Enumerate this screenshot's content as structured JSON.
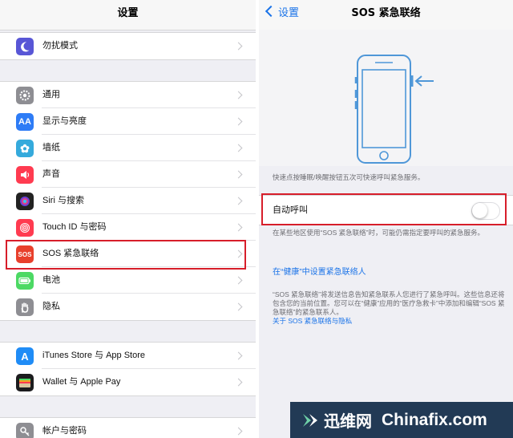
{
  "left": {
    "title": "设置",
    "items": [
      {
        "label": "勿扰模式",
        "icon": "moon-icon",
        "color": "#5856d6"
      },
      {
        "label": "通用",
        "icon": "gear-icon",
        "color": "#8e8e93"
      },
      {
        "label": "显示与亮度",
        "icon": "aa-icon",
        "glyph": "AA",
        "color": "#2e7cf6"
      },
      {
        "label": "墙纸",
        "icon": "flower-icon",
        "glyph": "✿",
        "color": "#35aadc"
      },
      {
        "label": "声音",
        "icon": "speaker-icon",
        "glyph": "🔊",
        "color": "#ff3b50"
      },
      {
        "label": "Siri 与搜索",
        "icon": "siri-icon",
        "color": "#222222"
      },
      {
        "label": "Touch ID 与密码",
        "icon": "fingerprint-icon",
        "color": "#ff3b50"
      },
      {
        "label": "SOS 紧急联络",
        "icon": "sos-icon",
        "glyph": "SOS",
        "color": "#e8402c"
      },
      {
        "label": "电池",
        "icon": "battery-icon",
        "color": "#4cd964"
      },
      {
        "label": "隐私",
        "icon": "hand-icon",
        "glyph": "✋",
        "color": "#8e8e93"
      },
      {
        "label": "iTunes Store 与 App Store",
        "icon": "appstore-icon",
        "glyph": "A",
        "color": "#1f8cf6"
      },
      {
        "label": "Wallet 与 Apple Pay",
        "icon": "wallet-icon",
        "color": "#1c1c1e"
      },
      {
        "label": "帐户与密码",
        "icon": "key-icon",
        "color": "#8e8e93"
      }
    ]
  },
  "right": {
    "back_label": "设置",
    "title": "SOS 紧急联络",
    "quick_note": "快速点按睡眠/唤醒按钮五次可快速呼叫紧急服务。",
    "auto_call_label": "自动呼叫",
    "auto_call_on": false,
    "auto_note": "在某些地区使用“SOS 紧急联络”时，可能仍需指定要呼叫的紧急服务。",
    "health_link": "在“健康”中设置紧急联络人",
    "footer_note": "“SOS 紧急联络”将发送信息告知紧急联系人您进行了紧急呼叫。这些信息还将包含您的当前位置。您可以在“健康”应用的“医疗急救卡”中添加和编辑“SOS 紧急联络”的紧急联系人。",
    "privacy_link": "关于 SOS 紧急联络与隐私"
  },
  "watermark": {
    "cn": "迅维网",
    "en": "Chinafix.com"
  },
  "colors": {
    "accent": "#1a73e8",
    "highlight": "#d71e2a",
    "illustration": "#4f97d8"
  }
}
